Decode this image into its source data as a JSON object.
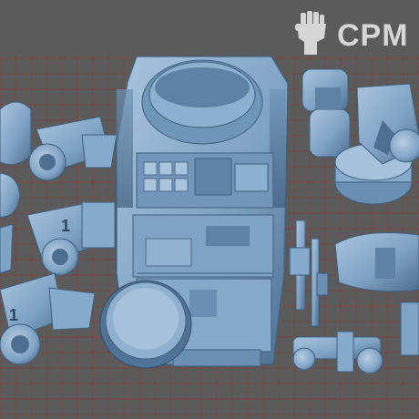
{
  "watermark": {
    "text": "CPM",
    "icon": "raised-fist-icon",
    "color": "#d6d6d6"
  },
  "scene": {
    "background_color": "#5b5b5b",
    "grid_color": "#8a3a3a",
    "model_color": "#7fa3c4",
    "model_shadow": "#4d6f90",
    "model_highlight": "#a9c5de",
    "decal_text": "1"
  }
}
